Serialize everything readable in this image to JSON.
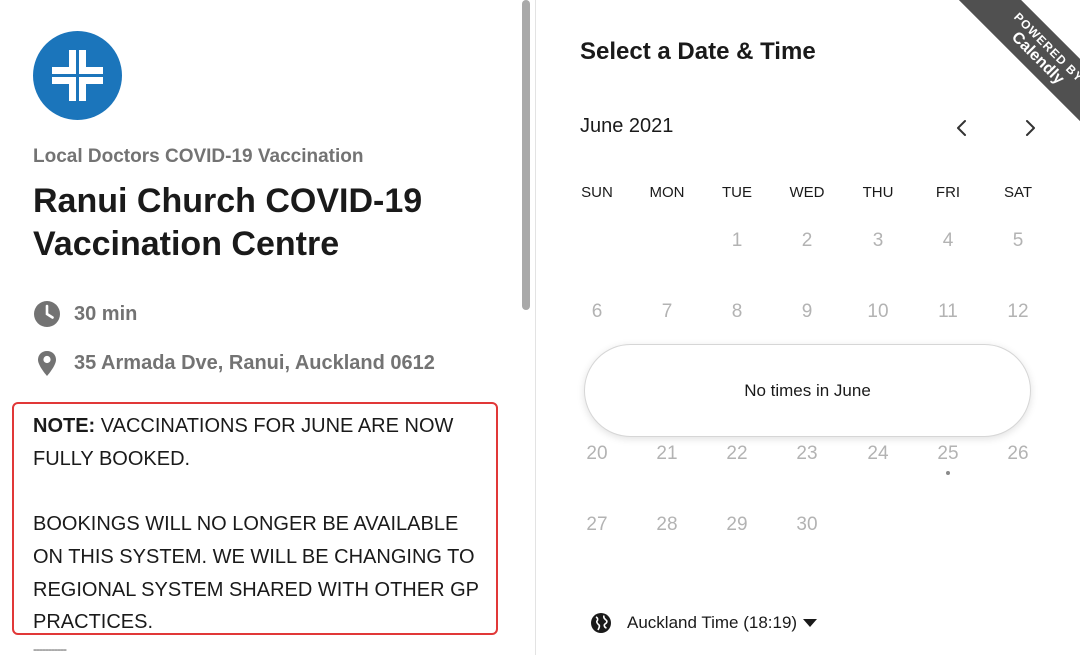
{
  "event": {
    "organizer": "Local Doctors COVID-19 Vaccination",
    "title": "Ranui Church COVID-19 Vaccination Centre",
    "duration": "30 min",
    "location": "35 Armada Dve, Ranui, Auckland 0612",
    "note": {
      "label": "NOTE:",
      "line1": " VACCINATIONS FOR JUNE ARE NOW FULLY BOOKED.",
      "line2": "BOOKINGS WILL NO LONGER BE AVAILABLE ON THIS SYSTEM. WE WILL BE CHANGING TO REGIONAL SYSTEM SHARED WITH OTHER GP PRACTICES."
    },
    "trailing": "-----------"
  },
  "scheduler": {
    "title": "Select a Date & Time",
    "month_label": "June 2021",
    "weekdays": [
      "SUN",
      "MON",
      "TUE",
      "WED",
      "THU",
      "FRI",
      "SAT"
    ],
    "weeks": [
      [
        "",
        "",
        "1",
        "2",
        "3",
        "4",
        "5"
      ],
      [
        "6",
        "7",
        "8",
        "9",
        "10",
        "11",
        "12"
      ],
      [
        "20",
        "21",
        "22",
        "23",
        "24",
        "25",
        "26"
      ],
      [
        "27",
        "28",
        "29",
        "30",
        "",
        "",
        ""
      ]
    ],
    "no_times_message": "No times in June",
    "timezone_label": "Auckland Time (18:19)"
  },
  "ribbon": {
    "line1": "POWERED BY",
    "line2": "Calendly"
  },
  "colors": {
    "brand_blue": "#1b75bb",
    "note_border": "#e13838",
    "muted_text": "#737373",
    "disabled_day": "#b3b3b3",
    "ribbon_bg": "#505050"
  },
  "icons": {
    "logo": "medical-cross-logo",
    "duration": "clock-icon",
    "location": "map-pin-icon",
    "prev": "chevron-left-icon",
    "next": "chevron-right-icon",
    "timezone": "globe-icon",
    "dropdown": "caret-down-icon"
  }
}
